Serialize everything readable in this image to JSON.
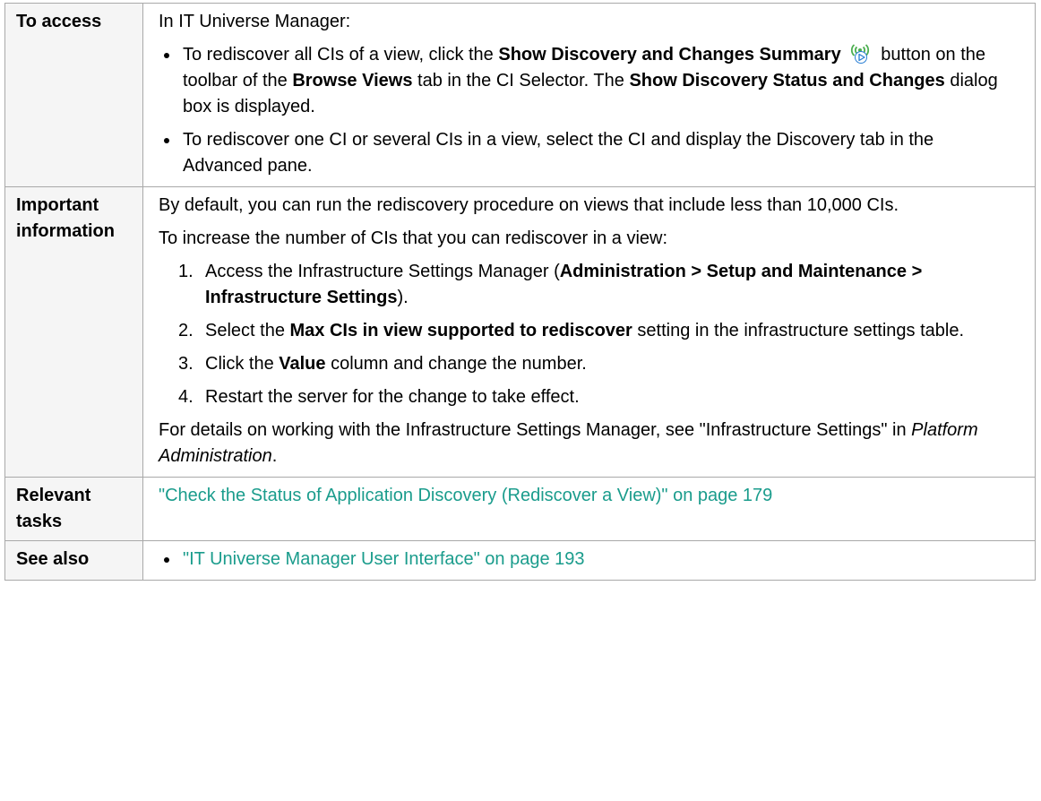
{
  "rows": {
    "access": {
      "label": "To access",
      "intro": "In IT Universe Manager:",
      "bullet1": {
        "t1": "To rediscover all CIs of a view, click the ",
        "b1": "Show Discovery and Changes Summary",
        "t2": " button on the toolbar of the ",
        "b2": "Browse Views",
        "t3": " tab in the CI Selector. The ",
        "b3": "Show Discovery Status and Changes",
        "t4": " dialog box is displayed.",
        "icon": "discovery-summary-icon"
      },
      "bullet2": "To rediscover one CI or several CIs in a view, select the CI and display the Discovery tab in the Advanced pane."
    },
    "important": {
      "label": "Important information",
      "p1": "By default, you can run the rediscovery procedure on views that include less than 10,000 CIs.",
      "p2": "To increase the number of CIs that you can rediscover in a view:",
      "step1": {
        "num": "1.",
        "t1": "Access the Infrastructure Settings Manager (",
        "b1": "Administration > Setup and Maintenance > Infrastructure Settings",
        "t2": ")."
      },
      "step2": {
        "num": "2.",
        "t1": "Select the ",
        "b1": "Max CIs in view supported to rediscover",
        "t2": " setting in the infrastructure settings table."
      },
      "step3": {
        "num": "3.",
        "t1": "Click the ",
        "b1": "Value",
        "t2": " column and change the number."
      },
      "step4": {
        "num": "4.",
        "t1": "Restart the server for the change to take effect."
      },
      "p3": {
        "t1": "For details on working with the Infrastructure Settings Manager, see \"Infrastructure Settings\" in ",
        "i1": "Platform Administration",
        "t2": "."
      }
    },
    "tasks": {
      "label": "Relevant tasks",
      "link": "\"Check the Status of Application Discovery (Rediscover a View)\" on page 179"
    },
    "see_also": {
      "label": "See also",
      "link": "\"IT Universe Manager User Interface\" on page 193"
    }
  },
  "colors": {
    "link": "#1a9c8c",
    "border": "#a9a9a9",
    "label_bg": "#f5f5f5",
    "icon_green": "#4caf50",
    "icon_blue": "#2a7fd4"
  }
}
